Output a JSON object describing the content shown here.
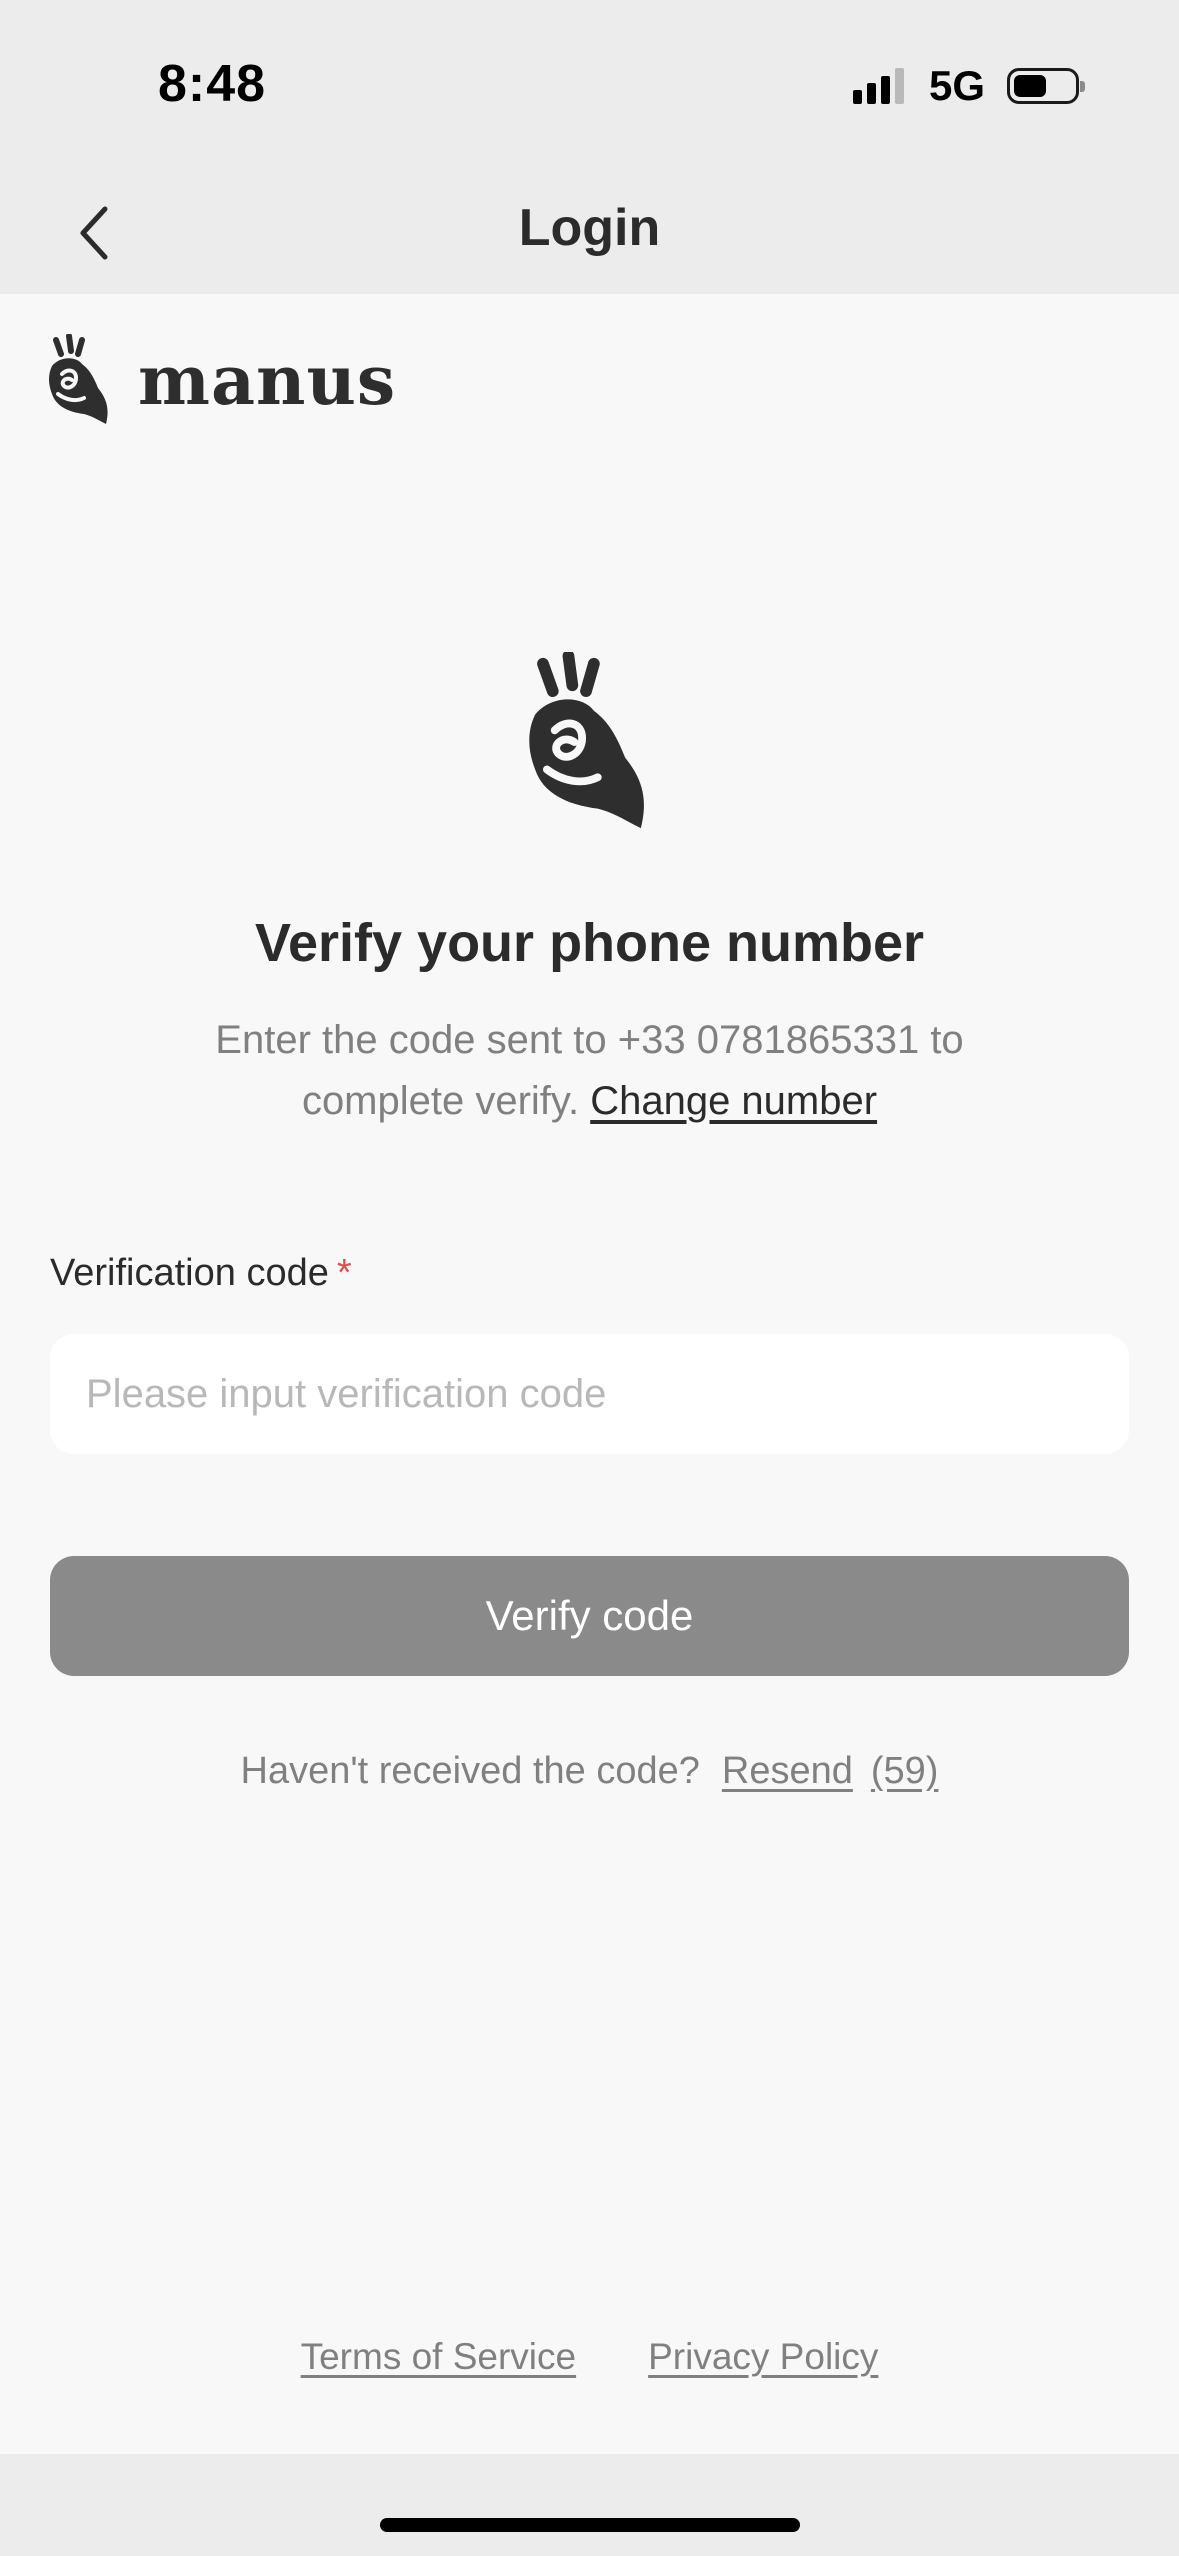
{
  "status_bar": {
    "time": "8:48",
    "network": "5G"
  },
  "nav": {
    "title": "Login",
    "back_icon": "chevron-left-icon"
  },
  "brand": {
    "logo_icon": "manus-hand-icon",
    "name": "manus"
  },
  "verify": {
    "title": "Verify your phone number",
    "description": "Enter the code sent to +33 0781865331 to complete verify.",
    "change_number_label": "Change number",
    "field_label": "Verification code",
    "required_mark": "*",
    "input_value": "",
    "input_placeholder": "Please input verification code",
    "submit_label": "Verify code",
    "resend_prompt": "Haven't received the code?",
    "resend_label": "Resend",
    "resend_countdown": "(59)"
  },
  "footer": {
    "terms_label": "Terms of Service",
    "privacy_label": "Privacy Policy"
  },
  "colors": {
    "background": "#f8f8f8",
    "bar_background": "#ececec",
    "button_disabled": "#8a8a8a",
    "required_red": "#e24b4b",
    "muted_text": "#808080",
    "primary_text": "#2b2b2b"
  }
}
